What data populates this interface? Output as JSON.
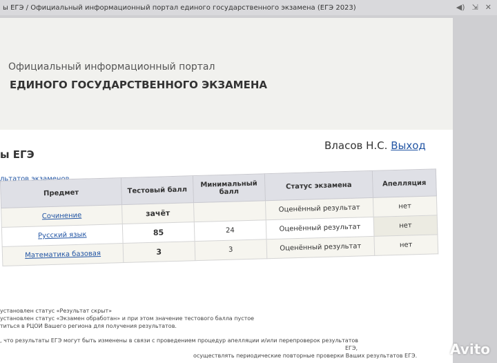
{
  "browser": {
    "tab_title": "ы ЕГЭ / Официальный информационный портал единого государственного экзамена (ЕГЭ 2023)",
    "icons": [
      "speaker-icon",
      "tab-expand-icon",
      "close-icon"
    ]
  },
  "portal": {
    "line1": "Официальный информационный портал",
    "line2": "ЕДИНОГО ГОСУДАРСТВЕННОГО ЭКЗАМЕНА"
  },
  "section": {
    "title": "ы ЕГЭ"
  },
  "user": {
    "name": "Власов Н.С.",
    "logout": "Выход"
  },
  "results_link": "льтатов экзаменов",
  "table": {
    "headers": {
      "subject": "Предмет",
      "score": "Тестовый балл",
      "min_score": "Минимальный балл",
      "status": "Статус экзамена",
      "appeal": "Апелляция"
    },
    "rows": [
      {
        "subject": "Сочинение",
        "score": "зачёт",
        "min_score": "",
        "status": "Оценённый результат",
        "appeal": "нет"
      },
      {
        "subject": "Русский язык",
        "score": "85",
        "min_score": "24",
        "status": "Оценённый результат",
        "appeal": "нет"
      },
      {
        "subject": "Математика базовая",
        "score": "3",
        "min_score": "3",
        "status": "Оценённый результат",
        "appeal": "нет"
      }
    ]
  },
  "notes": [
    "установлен статус «Результат скрыт»",
    "установлен статус «Экзамен обработан» и при этом значение тестового балла пустое",
    "титься в РЦОИ Вашего региона для получения результатов.",
    ", что результаты ЕГЭ могут быть изменены в связи с проведением процедур апелляции и/или перепроверок результатов",
    "ЕГЭ,",
    "осуществлять периодические повторные проверки Ваших результатов ЕГЭ."
  ],
  "watermark": "Avito"
}
